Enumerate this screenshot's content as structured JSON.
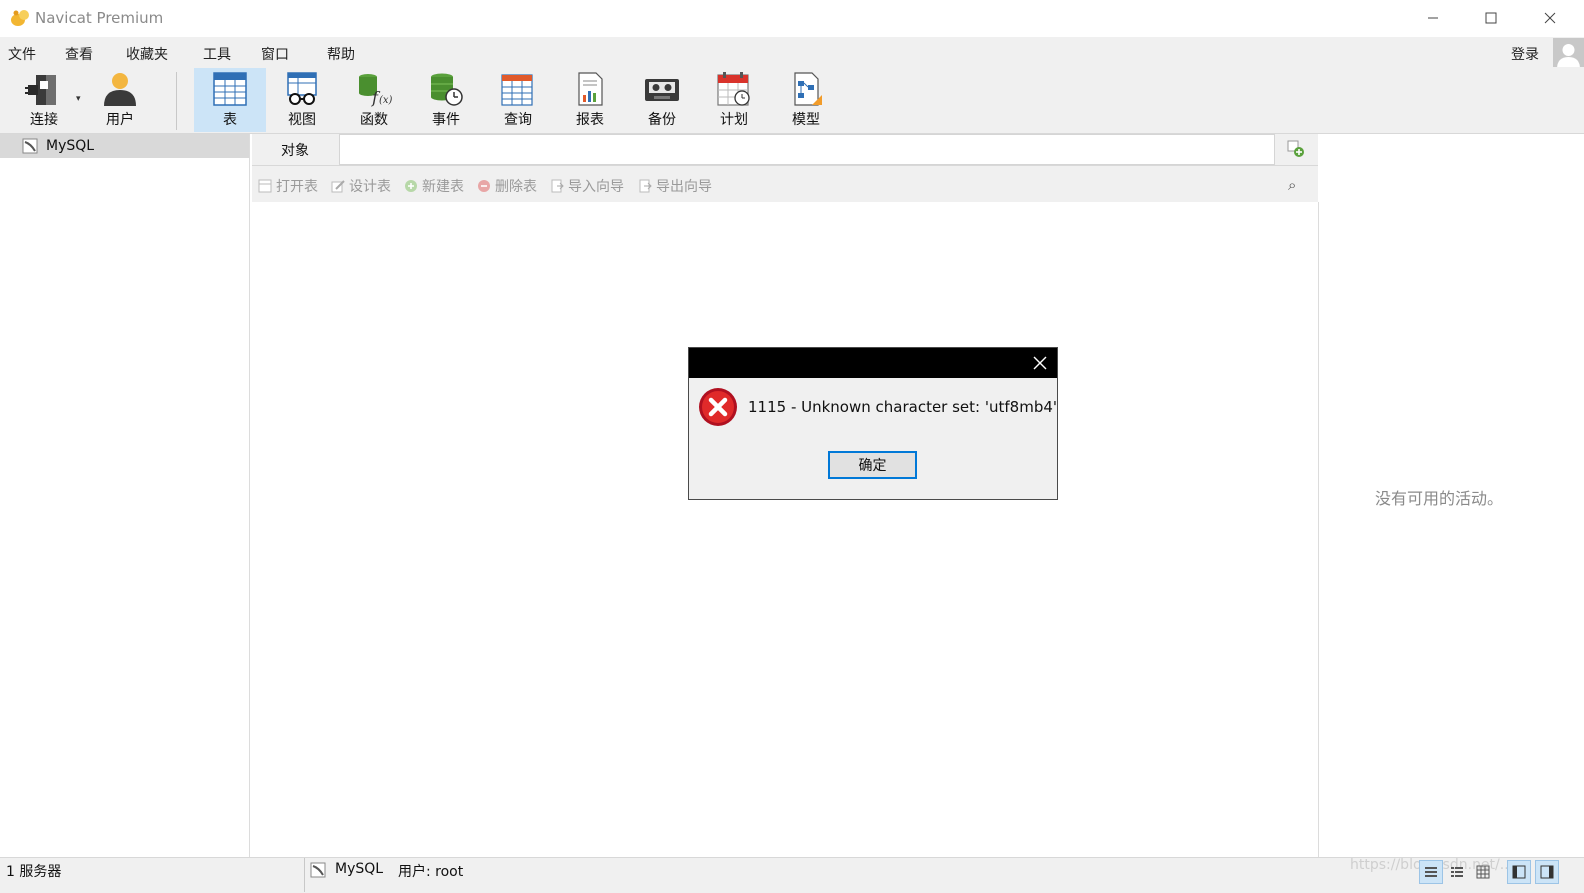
{
  "window": {
    "title": "Navicat Premium"
  },
  "menu": [
    "文件",
    "查看",
    "收藏夹",
    "工具",
    "窗口",
    "帮助"
  ],
  "account": {
    "login_label": "登录"
  },
  "toolbar": [
    {
      "label": "连接",
      "icon": "connection-plug-icon"
    },
    {
      "label": "用户",
      "icon": "user-icon"
    },
    {
      "label": "表",
      "icon": "table-icon",
      "active": true
    },
    {
      "label": "视图",
      "icon": "view-glasses-icon"
    },
    {
      "label": "函数",
      "icon": "function-icon"
    },
    {
      "label": "事件",
      "icon": "event-clock-icon"
    },
    {
      "label": "查询",
      "icon": "query-icon"
    },
    {
      "label": "报表",
      "icon": "report-icon"
    },
    {
      "label": "备份",
      "icon": "backup-tape-icon"
    },
    {
      "label": "计划",
      "icon": "schedule-calendar-icon"
    },
    {
      "label": "模型",
      "icon": "model-icon"
    }
  ],
  "navigator": {
    "items": [
      {
        "label": "MySQL",
        "icon": "mysql-connection-icon"
      }
    ]
  },
  "tabs": {
    "objects_label": "对象"
  },
  "object_toolbar": [
    "打开表",
    "设计表",
    "新建表",
    "删除表",
    "导入向导",
    "导出向导"
  ],
  "info_pane": {
    "empty_text": "没有可用的活动。"
  },
  "statusbar": {
    "count": "1 服务器",
    "connection": "MySQL",
    "user": "用户: root",
    "watermark": "https://blog.csdn.net/..."
  },
  "dialog": {
    "message": "1115 - Unknown character set: 'utf8mb4'",
    "ok_label": "确定"
  },
  "colors": {
    "accent": "#0078d7",
    "active_bg": "#cce4f7",
    "error": "#c8102e"
  }
}
